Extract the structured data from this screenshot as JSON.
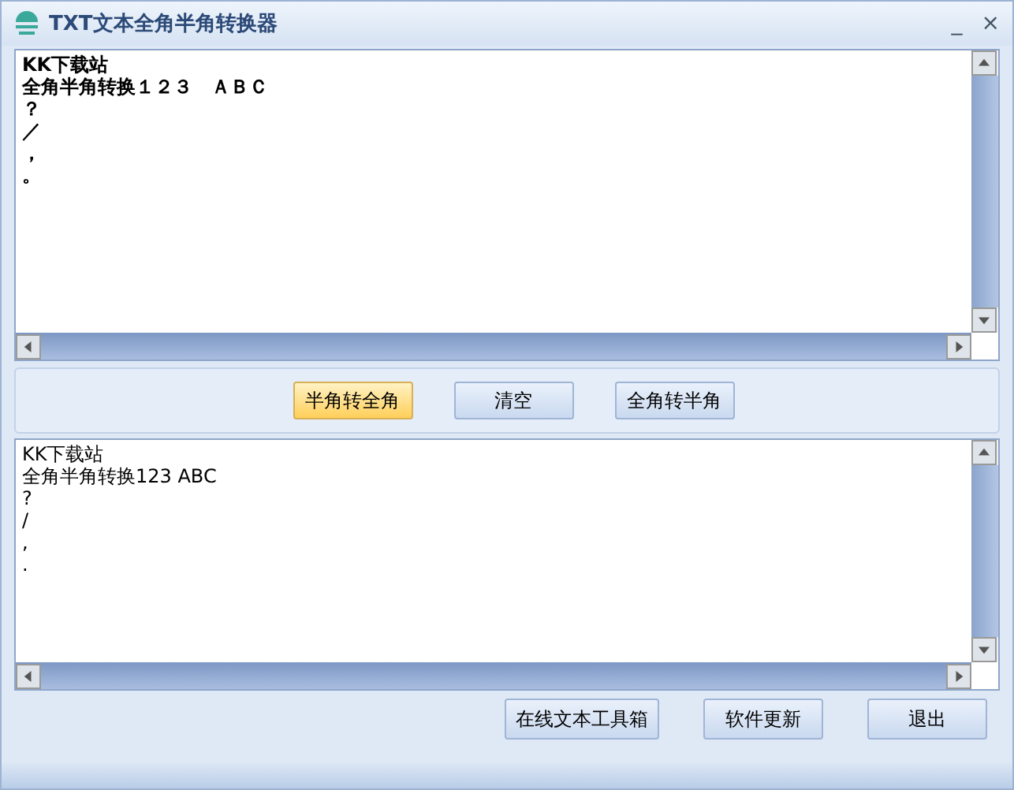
{
  "window": {
    "title": "TXT文本全角半角转换器",
    "minimize": "_",
    "close": "×"
  },
  "input": {
    "lines": [
      "KK下载站",
      "全角半角转换１２３　ＡＢＣ",
      "？",
      "／",
      "，",
      "。"
    ]
  },
  "convert_buttons": [
    {
      "label": "半角转全角",
      "highlighted": true
    },
    {
      "label": "清空",
      "highlighted": false
    },
    {
      "label": "全角转半角",
      "highlighted": false
    }
  ],
  "output": {
    "lines": [
      "KK下载站",
      "全角半角转换123 ABC",
      "?",
      "/",
      ",",
      "."
    ]
  },
  "footer_buttons": [
    {
      "label": "在线文本工具箱",
      "highlighted": false
    },
    {
      "label": "软件更新",
      "highlighted": false
    },
    {
      "label": "退出",
      "highlighted": false
    }
  ]
}
